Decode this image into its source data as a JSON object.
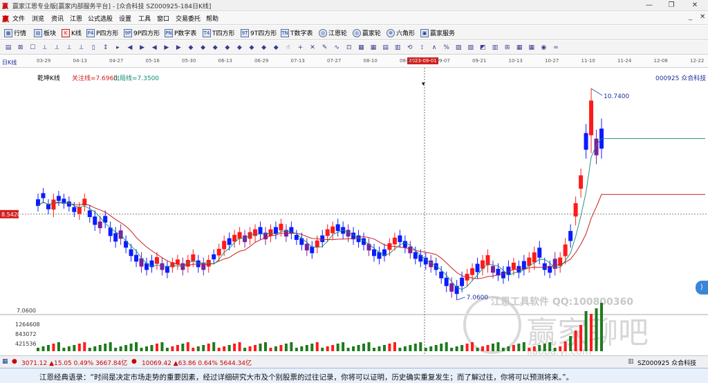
{
  "window": {
    "title": "赢家江恩专业版[赢家内部服务平台] - [众合科技  SZ000925-184日K线]",
    "min": "—",
    "max": "❐",
    "close": "✕"
  },
  "menu": [
    "文件",
    "浏览",
    "资讯",
    "江恩",
    "公式选股",
    "设置",
    "工具",
    "窗口",
    "交易委托",
    "帮助"
  ],
  "menu_right": [
    "_",
    "✕"
  ],
  "toolbar1": [
    {
      "icon": "▦",
      "label": "行情"
    },
    {
      "icon": "▤",
      "label": "板块"
    },
    {
      "icon": "K",
      "label": "K线",
      "red": true
    },
    {
      "icon": "P4",
      "label": "P四方形"
    },
    {
      "icon": "9P",
      "label": "9P四方形"
    },
    {
      "icon": "PN",
      "label": "P数字表"
    },
    {
      "icon": "T4",
      "label": "T四方形"
    },
    {
      "icon": "9T",
      "label": "9T四方形"
    },
    {
      "icon": "TN",
      "label": "T数字表"
    },
    {
      "icon": "◎",
      "label": "江恩轮",
      "round": true
    },
    {
      "icon": "◎",
      "label": "赢家轮",
      "round": true
    },
    {
      "icon": "✲",
      "label": "六角形",
      "round": true
    },
    {
      "icon": "▣",
      "label": "赢家服务"
    }
  ],
  "toolbar2_icons": [
    "▤",
    "⊠",
    "☐",
    "⟂",
    "⟂",
    "⟂",
    "⟂",
    "▯",
    "↕",
    "▸",
    "◀",
    "▶",
    "◀",
    "▶",
    "▶",
    "◆",
    "◆",
    "◆",
    "◆",
    "◆",
    "◆",
    "◆",
    "◆",
    "☝",
    "+",
    "✕",
    "✎",
    "∿",
    "⊡",
    "▦",
    "▦",
    "▤",
    "▥",
    "⟲",
    "⟟",
    "∧",
    "%",
    "▨",
    "▧",
    "◩",
    "▥",
    "⊞",
    "▦",
    "▦",
    "◉",
    "∞"
  ],
  "timeaxis": {
    "label": "日K线",
    "dates": [
      "03-29",
      "04-13",
      "04-27",
      "05-16",
      "05-30",
      "06-13",
      "06-29",
      "07-13",
      "07-27",
      "08-10",
      "08-24",
      "09-07",
      "09-21",
      "10-13",
      "10-27",
      "11-10",
      "11-24",
      "12-08",
      "12-22"
    ],
    "cursor": "2023-09-01"
  },
  "indicator": {
    "name": "乾坤K线",
    "focus_label": "关注线=7.6960",
    "exit_label": "出局线=7.3500"
  },
  "stock_label": "000925  众合科技",
  "price": {
    "cursor_level": "8.5420",
    "high_label": "10.7400",
    "low_label": "7.0600",
    "axis_low": "7.0600"
  },
  "volume_axis": [
    "1264608",
    "843072",
    "421536"
  ],
  "watermark": {
    "line1": "江恩工具软件   QQ:100800360",
    "brand": "赢家聊吧",
    "url": "liaoba.yj.com"
  },
  "status": {
    "sh": "3071.12 ▲15.05 0.49% 3667.84亿",
    "sz": "10069.42 ▲63.86 0.64% 5644.34亿",
    "code": "SZ000925 众合科技"
  },
  "quote": "江恩经典语录：“时间是决定市场走势的重要因素，经过详细研究大市及个别股票的过往记录，你将可以证明，历史确实重复发生；而了解过往，你将可以预测将来。”。",
  "colors": {
    "up": "#ff1a1a",
    "down": "#0a1cff",
    "purple": "#7b1fa2",
    "ma": "#c81e1e",
    "line": "#0e8a74",
    "vol": "#1e7a1e"
  },
  "chart_data": {
    "type": "candlestick",
    "candles": [
      [
        8.65,
        8.85
      ],
      [
        8.8,
        8.95
      ],
      [
        8.6,
        8.75
      ],
      [
        8.55,
        8.85
      ],
      [
        8.75,
        8.9
      ],
      [
        8.7,
        8.85
      ],
      [
        8.65,
        8.8
      ],
      [
        8.55,
        8.7
      ],
      [
        8.5,
        8.7
      ],
      [
        8.65,
        8.85
      ],
      [
        8.45,
        8.65
      ],
      [
        8.3,
        8.55
      ],
      [
        8.25,
        8.45
      ],
      [
        8.35,
        8.55
      ],
      [
        8.1,
        8.35
      ],
      [
        8.0,
        8.25
      ],
      [
        8.05,
        8.3
      ],
      [
        7.9,
        8.1
      ],
      [
        7.75,
        7.95
      ],
      [
        7.65,
        7.85
      ],
      [
        7.55,
        7.8
      ],
      [
        7.5,
        7.7
      ],
      [
        7.55,
        7.75
      ],
      [
        7.6,
        7.8
      ],
      [
        7.5,
        7.7
      ],
      [
        7.45,
        7.65
      ],
      [
        7.55,
        7.7
      ],
      [
        7.6,
        7.75
      ],
      [
        7.5,
        7.7
      ],
      [
        7.55,
        7.75
      ],
      [
        7.65,
        7.85
      ],
      [
        7.55,
        7.75
      ],
      [
        7.5,
        7.7
      ],
      [
        7.55,
        7.75
      ],
      [
        7.7,
        7.85
      ],
      [
        7.75,
        7.95
      ],
      [
        7.85,
        8.1
      ],
      [
        7.95,
        8.15
      ],
      [
        8.0,
        8.2
      ],
      [
        8.05,
        8.25
      ],
      [
        8.0,
        8.2
      ],
      [
        8.05,
        8.25
      ],
      [
        8.1,
        8.3
      ],
      [
        8.15,
        8.35
      ],
      [
        8.05,
        8.25
      ],
      [
        8.1,
        8.3
      ],
      [
        8.15,
        8.35
      ],
      [
        8.2,
        8.4
      ],
      [
        8.1,
        8.3
      ],
      [
        8.15,
        8.35
      ],
      [
        8.05,
        8.2
      ],
      [
        7.95,
        8.15
      ],
      [
        7.85,
        8.05
      ],
      [
        7.8,
        8.0
      ],
      [
        7.9,
        8.1
      ],
      [
        8.0,
        8.2
      ],
      [
        8.1,
        8.3
      ],
      [
        8.15,
        8.35
      ],
      [
        8.2,
        8.4
      ],
      [
        8.15,
        8.35
      ],
      [
        8.1,
        8.3
      ],
      [
        8.05,
        8.25
      ],
      [
        8.0,
        8.2
      ],
      [
        7.95,
        8.15
      ],
      [
        7.85,
        8.05
      ],
      [
        7.75,
        7.95
      ],
      [
        7.7,
        7.9
      ],
      [
        7.75,
        7.95
      ],
      [
        7.85,
        8.05
      ],
      [
        7.95,
        8.15
      ],
      [
        8.0,
        8.2
      ],
      [
        7.9,
        8.1
      ],
      [
        7.8,
        8.0
      ],
      [
        7.7,
        7.9
      ],
      [
        7.65,
        7.85
      ],
      [
        7.6,
        7.8
      ],
      [
        7.55,
        7.75
      ],
      [
        7.5,
        7.7
      ],
      [
        7.35,
        7.55
      ],
      [
        7.2,
        7.45
      ],
      [
        7.1,
        7.35
      ],
      [
        7.06,
        7.3
      ],
      [
        7.2,
        7.45
      ],
      [
        7.3,
        7.5
      ],
      [
        7.4,
        7.6
      ],
      [
        7.45,
        7.7
      ],
      [
        7.5,
        7.75
      ],
      [
        7.55,
        7.85
      ],
      [
        7.45,
        7.65
      ],
      [
        7.4,
        7.6
      ],
      [
        7.35,
        7.55
      ],
      [
        7.4,
        7.65
      ],
      [
        7.5,
        7.7
      ],
      [
        7.45,
        7.65
      ],
      [
        7.5,
        7.75
      ],
      [
        7.55,
        7.8
      ],
      [
        7.6,
        7.9
      ],
      [
        7.7,
        8.0
      ],
      [
        7.5,
        7.7
      ],
      [
        7.45,
        7.65
      ],
      [
        7.5,
        7.8
      ],
      [
        7.55,
        7.8
      ],
      [
        7.7,
        8.05
      ],
      [
        8.0,
        8.3
      ],
      [
        8.4,
        8.8
      ],
      [
        8.9,
        9.3
      ],
      [
        9.6,
        10.1
      ],
      [
        9.7,
        10.74
      ],
      [
        9.5,
        10.0
      ],
      [
        9.6,
        10.2
      ]
    ],
    "ylim": [
      6.8,
      10.9
    ],
    "xlim": [
      0,
      110
    ]
  }
}
